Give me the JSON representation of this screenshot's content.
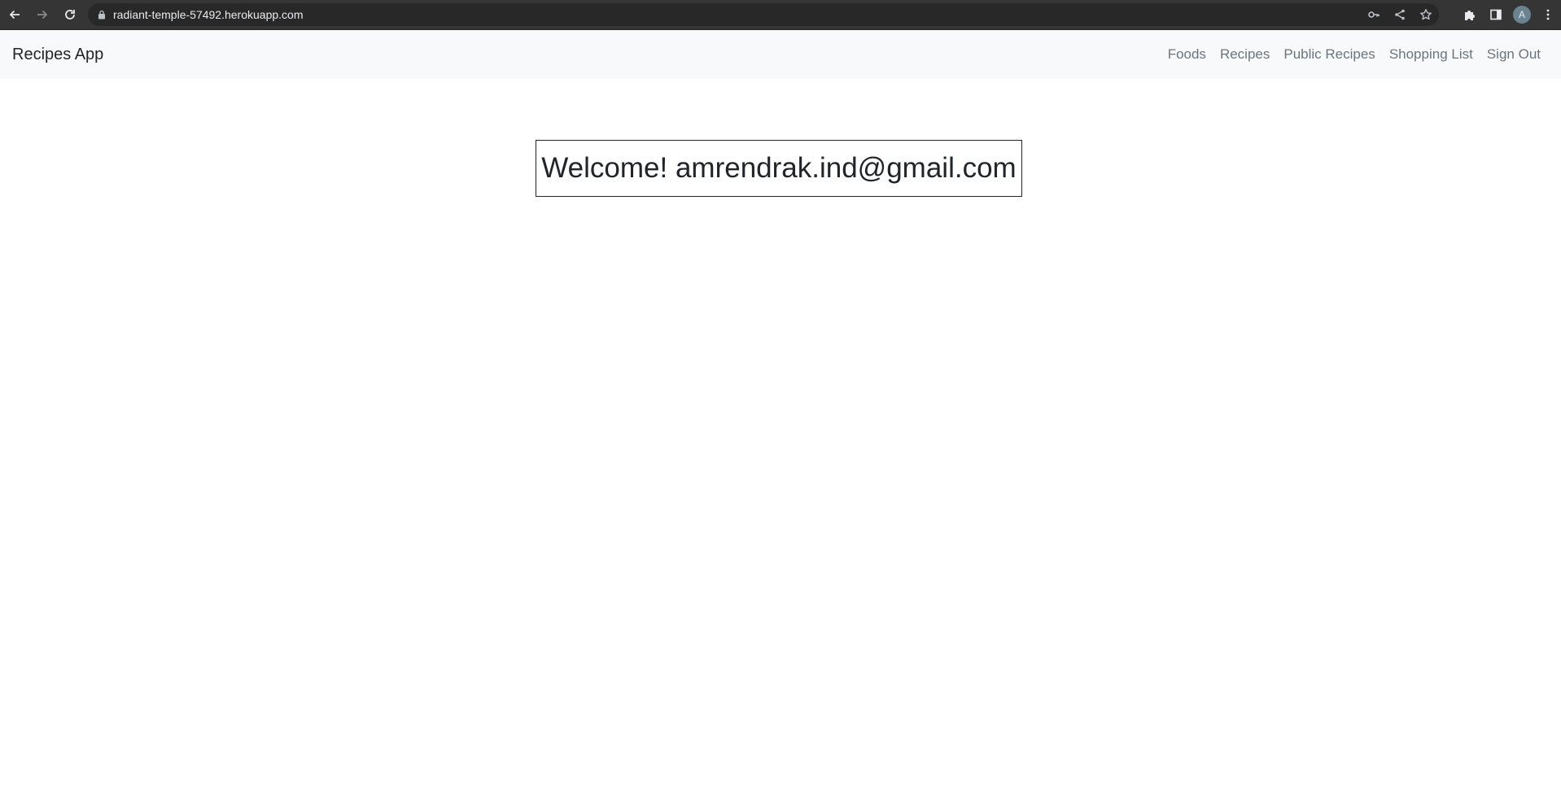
{
  "browser": {
    "url": "radiant-temple-57492.herokuapp.com",
    "profile_initial": "A",
    "icons": {
      "back": "back-arrow-icon",
      "forward": "forward-arrow-icon",
      "reload": "reload-icon",
      "lock": "lock-icon",
      "key": "key-icon",
      "share": "share-icon",
      "bookmark": "star-icon",
      "extensions": "puzzle-icon",
      "side_panel": "side-panel-icon",
      "menu": "kebab-menu-icon"
    }
  },
  "navbar": {
    "brand": "Recipes App",
    "links": [
      "Foods",
      "Recipes",
      "Public Recipes",
      "Shopping List",
      "Sign Out"
    ]
  },
  "main": {
    "welcome": "Welcome! amrendrak.ind@gmail.com"
  },
  "colors": {
    "chrome_bg": "#353535",
    "navbar_bg": "#f8f9fa",
    "link": "#6c757d",
    "text": "#212529"
  }
}
